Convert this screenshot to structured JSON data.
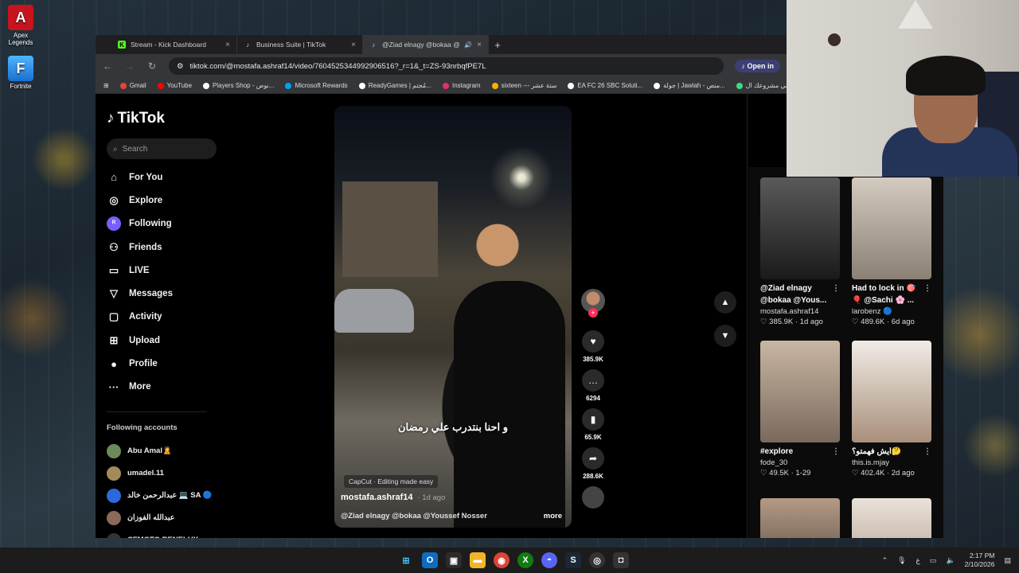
{
  "desktop": {
    "icons": [
      {
        "label": "Apex Legends",
        "glyph": "A"
      },
      {
        "label": "Fortnite",
        "glyph": "F"
      }
    ]
  },
  "browser": {
    "tabs": [
      {
        "title": "Stream - Kick Dashboard",
        "favicon": "K",
        "color": "#53fc18"
      },
      {
        "title": "Business Suite | TikTok",
        "favicon": "♪",
        "color": "#000000"
      },
      {
        "title": "@Ziad elnagy @bokaa @Yo",
        "favicon": "♪",
        "color": "#000000"
      }
    ],
    "url": "tiktok.com/@mostafa.ashraf14/video/7604525344992906516?_r=1&_t=ZS-93nrbqfPE7L",
    "open_in_app": "Open in",
    "bookmarks": [
      {
        "label": "Gmail",
        "color": "#ea4335"
      },
      {
        "label": "YouTube",
        "color": "#ff0000"
      },
      {
        "label": "Players Shop - نوص...",
        "color": "#ffffff"
      },
      {
        "label": "Microsoft Rewards",
        "color": "#00a4ef"
      },
      {
        "label": "ReadyGames | مُجتم...",
        "color": "#ffffff"
      },
      {
        "label": "Instagram",
        "color": "#e1306c"
      },
      {
        "label": "sixteen --- ستة عشر",
        "color": "#f5b400"
      },
      {
        "label": "EA FC 26 SBC Soluti...",
        "color": "#ffffff"
      },
      {
        "label": "جولة | Jawlah - منص...",
        "color": "#ffffff"
      },
      {
        "label": "قلي مشروعك ال...",
        "color": "#3ddc84"
      }
    ]
  },
  "tiktok": {
    "logo": "TikTok",
    "search_placeholder": "Search",
    "nav": [
      {
        "label": "For You",
        "icon": "⌂"
      },
      {
        "label": "Explore",
        "icon": "◎"
      },
      {
        "label": "Following",
        "icon": "ᴿ"
      },
      {
        "label": "Friends",
        "icon": "⚇"
      },
      {
        "label": "LIVE",
        "icon": "▭"
      },
      {
        "label": "Messages",
        "icon": "▽"
      },
      {
        "label": "Activity",
        "icon": "▢"
      },
      {
        "label": "Upload",
        "icon": "⊞"
      },
      {
        "label": "Profile",
        "icon": "●"
      },
      {
        "label": "More",
        "icon": "···"
      }
    ],
    "following_title": "Following accounts",
    "following": [
      {
        "name": "Abu Amal🙎"
      },
      {
        "name": "umadel.11"
      },
      {
        "name": "عبدالرحمن خالد 💻 SA 🔵"
      },
      {
        "name": "عبدالله الفوزان"
      },
      {
        "name": "CFMOTO BENELUX ..."
      }
    ],
    "video": {
      "subtitle": "و احنا بنتدرب علي رمضان",
      "capcut": "CapCut · Editing made easy",
      "author": "mostafa.ashraf14",
      "ago": "· 1d ago",
      "description": "@Ziad elnagy @bokaa @Youssef Nosser",
      "more": "more"
    },
    "actions": {
      "likes": "385.9K",
      "comments": "6294",
      "saves": "65.9K",
      "shares": "288.6K"
    }
  },
  "related": [
    {
      "title": "@Ziad elnagy @bokaa @Yous...",
      "author": "mostafa.ashraf14",
      "stats": "♡ 385.9K · 1d ago",
      "colors": [
        "#5a5a5a",
        "#1a1a1a"
      ]
    },
    {
      "title": "Had to lock in 🎯 🎈 @Sachi 🌸 ...",
      "author": "larobenz 🔵",
      "stats": "♡ 489.6K · 6d ago",
      "colors": [
        "#d4cbc0",
        "#8a8075"
      ]
    },
    {
      "title": "#explore",
      "author": "fode_30",
      "stats": "♡ 49.5K · 1-29",
      "colors": [
        "#c9b6a4",
        "#7a6a5c"
      ]
    },
    {
      "title": "ايش فهمتو؟🤔",
      "author": "this.is.mjay",
      "stats": "♡ 402.4K · 2d ago",
      "colors": [
        "#f1ece6",
        "#a88f7a"
      ]
    },
    {
      "title": "",
      "author": "",
      "stats": "",
      "colors": [
        "#b49a86",
        "#40342c"
      ]
    },
    {
      "title": "",
      "author": "",
      "stats": "",
      "colors": [
        "#e9e2da",
        "#a58b78"
      ]
    }
  ],
  "taskbar": {
    "time": "2:17 PM",
    "date": "2/10/2026",
    "lang": "ع"
  }
}
